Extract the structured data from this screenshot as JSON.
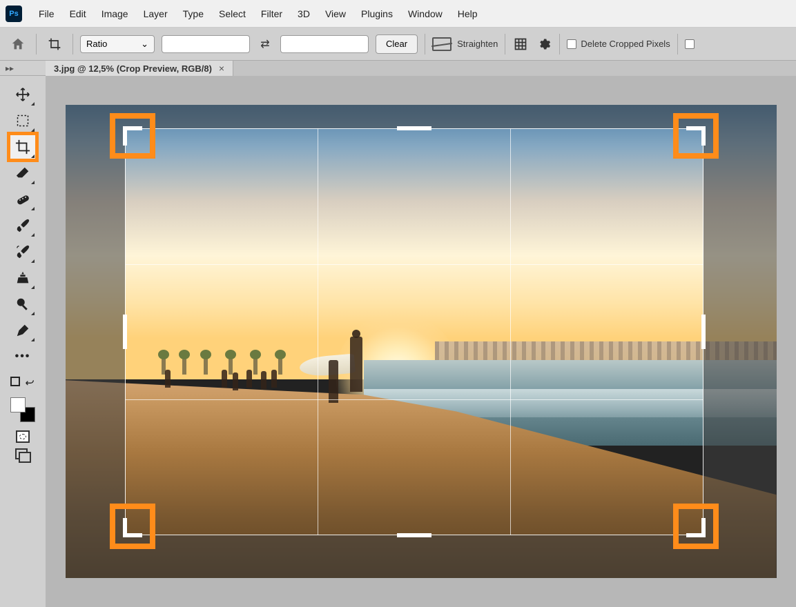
{
  "app": {
    "name": "Ps"
  },
  "menu": [
    "File",
    "Edit",
    "Image",
    "Layer",
    "Type",
    "Select",
    "Filter",
    "3D",
    "View",
    "Plugins",
    "Window",
    "Help"
  ],
  "options": {
    "ratio_label": "Ratio",
    "width": "",
    "height": "",
    "clear": "Clear",
    "straighten": "Straighten",
    "delete_cropped": "Delete Cropped Pixels"
  },
  "panel_toggle": "▸▸",
  "tab": {
    "title": "3.jpg @ 12,5% (Crop Preview, RGB/8)",
    "close": "×"
  },
  "tools": [
    {
      "name": "move-tool",
      "svg": "move"
    },
    {
      "name": "marquee-tool",
      "svg": "marquee"
    },
    {
      "name": "crop-tool",
      "svg": "crop",
      "active": true,
      "highlight": true
    },
    {
      "name": "eraser-tool",
      "svg": "eraser"
    },
    {
      "name": "healing-brush-tool",
      "svg": "bandaid"
    },
    {
      "name": "brush-tool",
      "svg": "brush"
    },
    {
      "name": "history-brush-tool",
      "svg": "histbrush"
    },
    {
      "name": "clone-stamp-tool",
      "svg": "stamp"
    },
    {
      "name": "dodge-tool",
      "svg": "dodge"
    },
    {
      "name": "pen-tool",
      "svg": "pen"
    },
    {
      "name": "more-tools",
      "svg": "dots"
    }
  ]
}
